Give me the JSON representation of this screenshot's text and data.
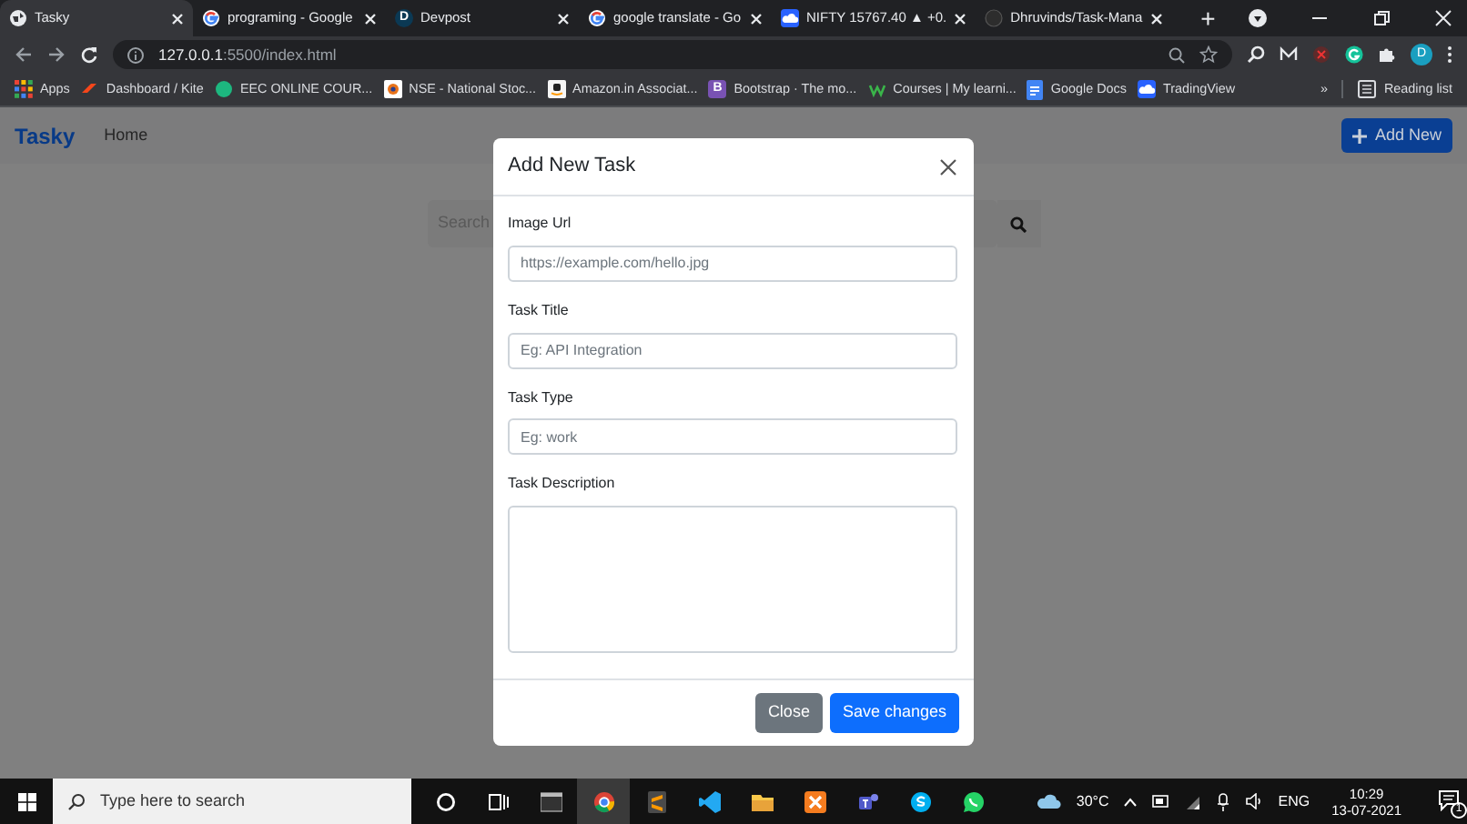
{
  "browser": {
    "tabs": [
      {
        "title": "Tasky",
        "selected": true
      },
      {
        "title": "programing - Google",
        "selected": false
      },
      {
        "title": "Devpost",
        "selected": false,
        "icon_letter": "D"
      },
      {
        "title": "google translate - Go",
        "selected": false
      },
      {
        "title": "NIFTY 15767.40 ▲ +0.",
        "selected": false
      },
      {
        "title": "Dhruvinds/Task-Mana",
        "selected": false
      }
    ],
    "new_tab": "+",
    "address": {
      "host": "127.0.0.1",
      "path": ":5500/index.html"
    },
    "profile_letter": "D",
    "bookmarks": [
      {
        "label": "Apps"
      },
      {
        "label": "Dashboard / Kite"
      },
      {
        "label": "EEC ONLINE COUR..."
      },
      {
        "label": "NSE - National Stoc..."
      },
      {
        "label": "Amazon.in Associat..."
      },
      {
        "label": "Bootstrap · The mo...",
        "icon_letter": "B"
      },
      {
        "label": "Courses | My learni..."
      },
      {
        "label": "Google Docs"
      },
      {
        "label": "TradingView"
      }
    ],
    "more": "»",
    "reading_list": "Reading list"
  },
  "page": {
    "brand": "Tasky",
    "nav_links": [
      "Home"
    ],
    "add_button": "Add New",
    "search_placeholder": "Search"
  },
  "modal": {
    "title": "Add New Task",
    "fields": [
      {
        "label": "Image Url",
        "kind": "input",
        "placeholder": "https://example.com/hello.jpg"
      },
      {
        "label": "Task Title",
        "kind": "input",
        "placeholder": "Eg: API Integration"
      },
      {
        "label": "Task Type",
        "kind": "input",
        "placeholder": "Eg: work"
      },
      {
        "label": "Task Description",
        "kind": "textarea"
      }
    ],
    "buttons": [
      {
        "label": "Close",
        "kind": "secondary"
      },
      {
        "label": "Save changes",
        "kind": "primary"
      }
    ]
  },
  "taskbar": {
    "search_placeholder": "Type here to search",
    "weather": "30°C",
    "language": "ENG",
    "time": "10:29",
    "date": "13-07-2021",
    "notifications": "1"
  }
}
